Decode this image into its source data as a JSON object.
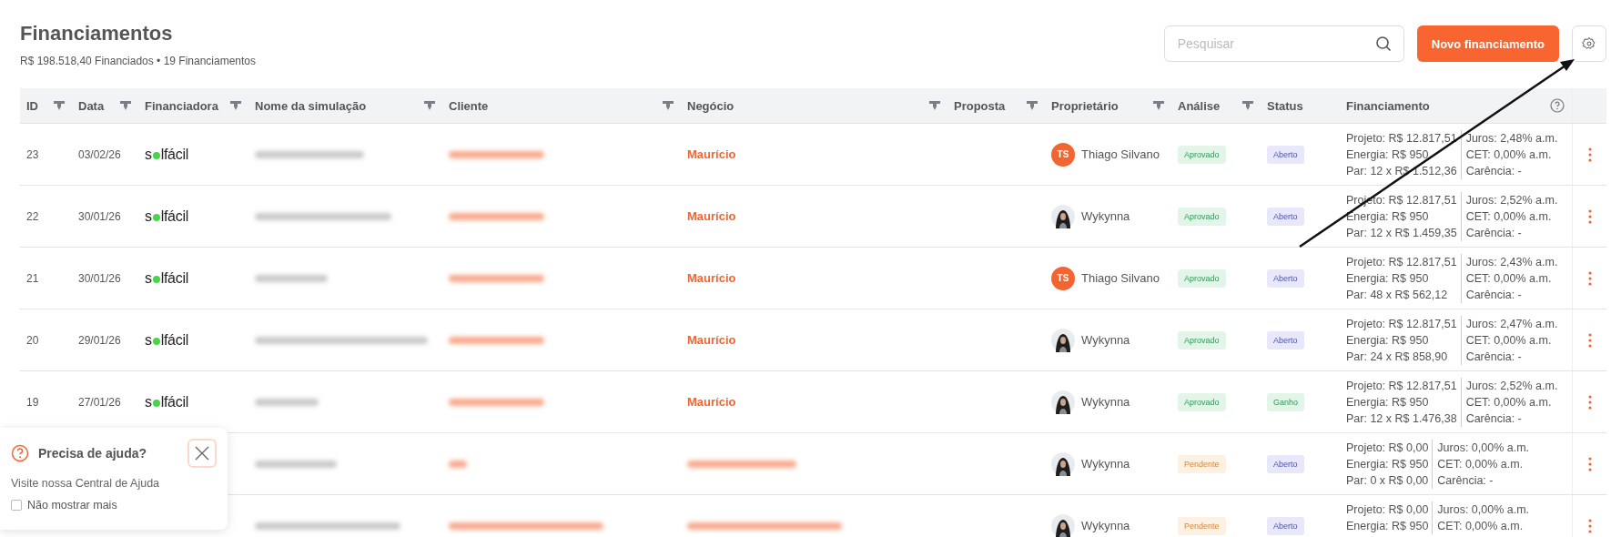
{
  "header": {
    "title": "Financiamentos",
    "subtitle": "R$ 198.518,40 Financiados • 19 Financiamentos"
  },
  "search": {
    "placeholder": "Pesquisar"
  },
  "new_button": "Novo financiamento",
  "columns": [
    {
      "label": "ID",
      "filter": true
    },
    {
      "label": "Data",
      "filter": true
    },
    {
      "label": "Financiadora",
      "filter": true
    },
    {
      "label": "Nome da simulação",
      "filter": true
    },
    {
      "label": "Cliente",
      "filter": true
    },
    {
      "label": "Negócio",
      "filter": true
    },
    {
      "label": "Proposta",
      "filter": true
    },
    {
      "label": "Proprietário",
      "filter": true
    },
    {
      "label": "Análise",
      "filter": true
    },
    {
      "label": "Status",
      "filter": false
    },
    {
      "label": "Financiamento",
      "filter": false
    }
  ],
  "rows": [
    {
      "id": "23",
      "date": "03/02/26",
      "lender": {
        "pre": "s",
        "post": "lfácil"
      },
      "negocio": "Maurício",
      "owner": {
        "kind": "initials",
        "initials": "TS",
        "name": "Thiago Silvano"
      },
      "analysis": {
        "label": "Aprovado",
        "kind": "approved"
      },
      "status": {
        "label": "Aberto",
        "kind": "open"
      },
      "fin": [
        "Projeto: R$ 12.817,51",
        "Energia: R$ 950",
        "Par: 12 x R$ 1.512,36"
      ],
      "rates": [
        "Juros: 2,48% a.m.",
        "CET: 0,00% a.m.",
        "Carência: -"
      ]
    },
    {
      "id": "22",
      "date": "30/01/26",
      "lender": {
        "pre": "s",
        "post": "lfácil"
      },
      "negocio": "Maurício",
      "owner": {
        "kind": "photo",
        "name": "Wykynna"
      },
      "analysis": {
        "label": "Aprovado",
        "kind": "approved"
      },
      "status": {
        "label": "Aberto",
        "kind": "open"
      },
      "fin": [
        "Projeto: R$ 12.817,51",
        "Energia: R$ 950",
        "Par: 12 x R$ 1.459,35"
      ],
      "rates": [
        "Juros: 2,52% a.m.",
        "CET: 0,00% a.m.",
        "Carência: -"
      ]
    },
    {
      "id": "21",
      "date": "30/01/26",
      "lender": {
        "pre": "s",
        "post": "lfácil"
      },
      "negocio": "Maurício",
      "owner": {
        "kind": "initials",
        "initials": "TS",
        "name": "Thiago Silvano"
      },
      "analysis": {
        "label": "Aprovado",
        "kind": "approved"
      },
      "status": {
        "label": "Aberto",
        "kind": "open"
      },
      "fin": [
        "Projeto: R$ 12.817,51",
        "Energia: R$ 950",
        "Par: 48 x R$ 562,12"
      ],
      "rates": [
        "Juros: 2,43% a.m.",
        "CET: 0,00% a.m.",
        "Carência: -"
      ]
    },
    {
      "id": "20",
      "date": "29/01/26",
      "lender": {
        "pre": "s",
        "post": "lfácil"
      },
      "negocio": "Maurício",
      "owner": {
        "kind": "photo",
        "name": "Wykynna"
      },
      "analysis": {
        "label": "Aprovado",
        "kind": "approved"
      },
      "status": {
        "label": "Aberto",
        "kind": "open"
      },
      "fin": [
        "Projeto: R$ 12.817,51",
        "Energia: R$ 950",
        "Par: 24 x R$ 858,90"
      ],
      "rates": [
        "Juros: 2,47% a.m.",
        "CET: 0,00% a.m.",
        "Carência: -"
      ]
    },
    {
      "id": "19",
      "date": "27/01/26",
      "lender": {
        "pre": "s",
        "post": "lfácil"
      },
      "negocio": "Maurício",
      "owner": {
        "kind": "photo",
        "name": "Wykynna"
      },
      "analysis": {
        "label": "Aprovado",
        "kind": "approved"
      },
      "status": {
        "label": "Ganho",
        "kind": "won"
      },
      "fin": [
        "Projeto: R$ 12.817,51",
        "Energia: R$ 950",
        "Par: 12 x R$ 1.476,38"
      ],
      "rates": [
        "Juros: 2,52% a.m.",
        "CET: 0,00% a.m.",
        "Carência: -"
      ]
    },
    {
      "owner": {
        "kind": "photo",
        "name": "Wykynna"
      },
      "analysis": {
        "label": "Pendente",
        "kind": "pending"
      },
      "status": {
        "label": "Aberto",
        "kind": "open"
      },
      "fin": [
        "Projeto: R$ 0,00",
        "Energia: R$ 950",
        "Par: 0 x R$ 0,00"
      ],
      "rates": [
        "Juros: 0,00% a.m.",
        "CET: 0,00% a.m.",
        "Carência: -"
      ]
    },
    {
      "owner": {
        "kind": "photo",
        "name": "Wykynna"
      },
      "analysis": {
        "label": "Pendente",
        "kind": "pending"
      },
      "status": {
        "label": "Aberto",
        "kind": "open"
      },
      "fin": [
        "Projeto: R$ 0,00",
        "Energia: R$ 950"
      ],
      "rates": [
        "Juros: 0,00% a.m.",
        "CET: 0,00% a.m."
      ]
    }
  ],
  "help": {
    "title": "Precisa de ajuda?",
    "link": "Visite nossa Central de Ajuda",
    "checkbox": {
      "label": "Não mostrar mais",
      "checked": false
    }
  }
}
